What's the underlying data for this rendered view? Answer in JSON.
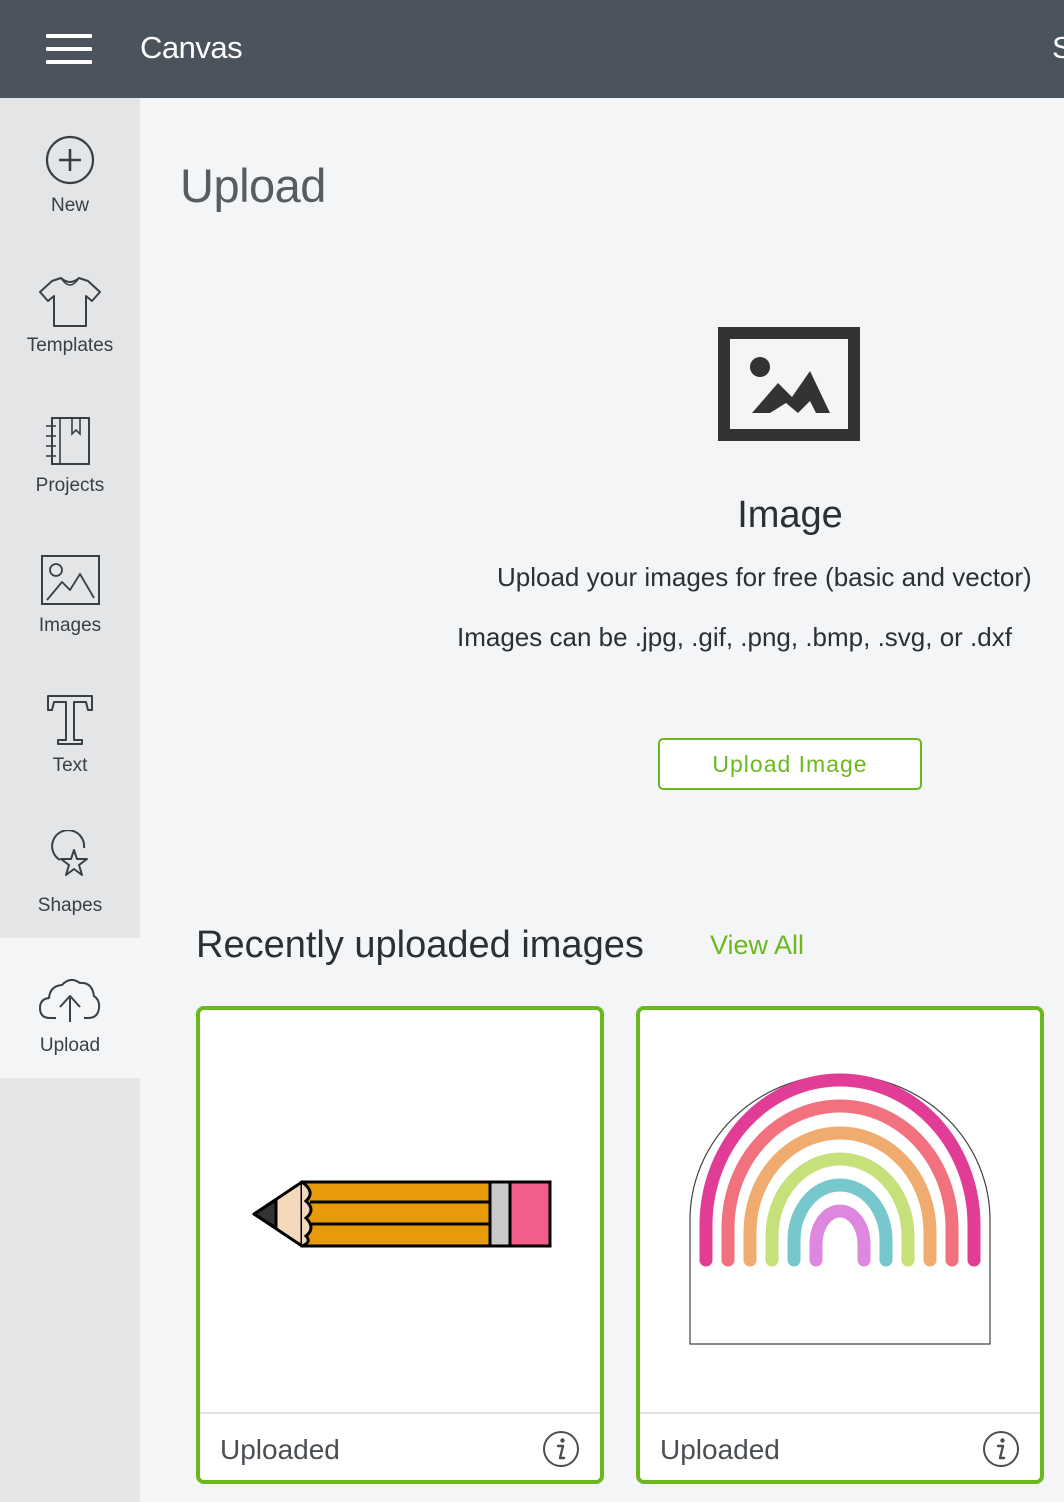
{
  "header": {
    "title": "Canvas",
    "right_cut_text": "S"
  },
  "sidebar": {
    "items": [
      {
        "label": "New",
        "icon": "plus-circle-icon"
      },
      {
        "label": "Templates",
        "icon": "tshirt-icon"
      },
      {
        "label": "Projects",
        "icon": "notebook-icon"
      },
      {
        "label": "Images",
        "icon": "image-icon"
      },
      {
        "label": "Text",
        "icon": "text-t-icon"
      },
      {
        "label": "Shapes",
        "icon": "shapes-icon"
      },
      {
        "label": "Upload",
        "icon": "cloud-upload-icon",
        "active": true
      }
    ]
  },
  "main": {
    "title": "Upload",
    "image_section": {
      "heading": "Image",
      "description_1": "Upload your images for free (basic and vector)",
      "description_2": "Images can be .jpg, .gif, .png, .bmp, .svg, or .dxf",
      "button": "Upload Image"
    },
    "recent": {
      "title": "Recently uploaded images",
      "view_all": "View All",
      "cards": [
        {
          "label": "Uploaded",
          "thumbnail": "pencil"
        },
        {
          "label": "Uploaded",
          "thumbnail": "rainbow"
        }
      ]
    }
  },
  "colors": {
    "header_bg": "#4b545c",
    "sidebar_bg": "#e4e5e7",
    "accent_green": "#6cb81f",
    "page_bg": "#f4f5f6"
  }
}
